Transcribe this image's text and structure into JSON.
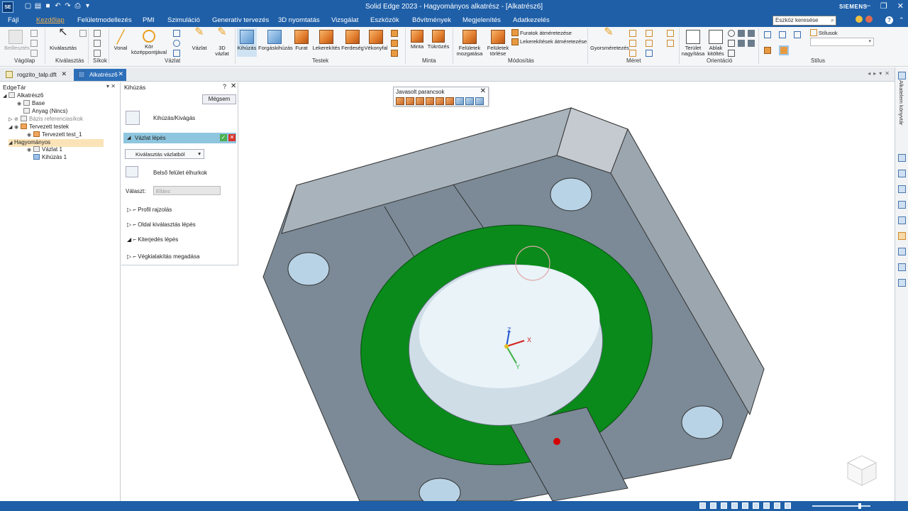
{
  "titlebar": {
    "app_logo": "SE",
    "title": "Solid Edge 2023 - Hagyományos alkatrész - [Alkatrész6]",
    "brand": "SIEMENS"
  },
  "menu": {
    "tabs": [
      "Fájl",
      "Kezdőlap",
      "Felületmodellezés",
      "PMI",
      "Szimuláció",
      "Generatív tervezés",
      "3D nyomtatás",
      "Vizsgálat",
      "Eszközök",
      "Bővítmények",
      "Megjelenítés",
      "Adatkezelés"
    ],
    "active_tab": "Kezdőlap",
    "search_placeholder": "Eszköz keresése"
  },
  "ribbon": {
    "groups": {
      "clipboard": "Vágólap",
      "select": "Kiválasztás",
      "planes": "Síkok",
      "sketch": "Vázlat",
      "solids": "Testek",
      "pattern": "Minta",
      "modify": "Módosítás",
      "dimension": "Méret",
      "orient": "Orientáció",
      "style": "Stílus"
    },
    "buttons": {
      "paste": "Beillesztés",
      "select": "Kiválasztás",
      "line": "Vonal",
      "circle": "Kör középpontjával",
      "sketch": "Vázlat",
      "sketch3d": "3D vázlat",
      "extrude": "Kihúzás",
      "revolve": "Forgáskihúzás",
      "hole": "Furat",
      "round": "Lekerekítés",
      "chamfer": "Ferdeség",
      "thinwall": "Vékonyfal",
      "pattern": "Minta",
      "mirror": "Tükrözés",
      "move_faces": "Felületek mozgatása",
      "delete_faces": "Felületek törlése",
      "hole_resize": "Furatok átméretezése",
      "round_resize": "Lekerekítések átméretezése",
      "smart_dim": "Gyorsméretezés",
      "zoom_area": "Terület nagyítása",
      "fit": "Ablak kitöltés",
      "styles": "Stílusok"
    }
  },
  "doctabs": [
    {
      "label": "rogzito_talp.dft",
      "active": false
    },
    {
      "label": "Alkatrész6",
      "active": true
    }
  ],
  "edgebar": {
    "title": "EdgeTár",
    "tree": [
      {
        "label": "Alkatrész6",
        "muted": false,
        "highlight": false
      },
      {
        "label": "Base",
        "muted": false,
        "highlight": false
      },
      {
        "label": "Anyag (Nincs)",
        "muted": false,
        "highlight": false
      },
      {
        "label": "Bázis referenciasíkok",
        "muted": true,
        "highlight": false
      },
      {
        "label": "Tervezett testek",
        "muted": false,
        "highlight": false
      },
      {
        "label": "Tervezett test_1",
        "muted": false,
        "highlight": false
      },
      {
        "label": "Hagyományos",
        "muted": false,
        "highlight": true
      },
      {
        "label": "Vázlat 1",
        "muted": false,
        "highlight": false
      },
      {
        "label": "Kihúzás 1",
        "muted": false,
        "highlight": false
      }
    ]
  },
  "command_panel": {
    "title": "Kihúzás",
    "help": "?",
    "cancel": "Mégsem",
    "mode": "Kihúzás/Kivágás",
    "step_active": "Vázlat lépés",
    "select_value": "Kiválasztás vázlatból",
    "inner_loops": "Belső felület élhurkok",
    "choose_label": "Választ:",
    "choose_value": "Ellánc",
    "steps": [
      "Profil rajzolás",
      "Oldal kiválasztás lépés",
      "Kiterjedés lépés",
      "Végkialakítás megadása"
    ]
  },
  "quickbar": {
    "title": "Javasolt parancsok"
  },
  "model": {
    "colors": {
      "plate_top": "#7b8a96",
      "plate_side": "#a9b3bb",
      "plate_edge": "#c4cad0",
      "ring": "#0a8a1a",
      "bore": "#d7e6ef",
      "hole": "#b9d3e6",
      "triad_x": "#d42020",
      "triad_y": "#3cb043",
      "triad_z": "#2050d0"
    },
    "triad": {
      "x": "X",
      "y": "Y",
      "z": "Z"
    }
  },
  "rightdock": {
    "label": "Alkatelem könyvtár"
  }
}
